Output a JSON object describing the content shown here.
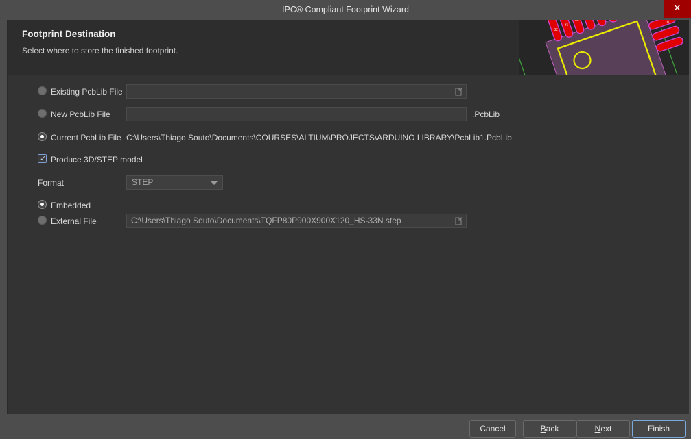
{
  "window": {
    "title": "IPC® Compliant Footprint Wizard",
    "close_label": "✕",
    "close_icon": "close-icon"
  },
  "banner": {
    "heading": "Footprint Destination",
    "subheading": "Select where to store the finished footprint.",
    "artwork": "pcb-footprint-preview"
  },
  "form": {
    "destination_group": {
      "options": [
        {
          "id": "existing-pcblib-file",
          "label": "Existing PcbLib File",
          "selected": false,
          "field_value": "",
          "field_placeholder": "",
          "has_browse": true,
          "browse_icon": "browse-file-icon"
        },
        {
          "id": "new-pcblib-file",
          "label": "New PcbLib File",
          "selected": false,
          "field_value": "",
          "field_placeholder": "",
          "suffix": ".PcbLib",
          "has_browse": false
        },
        {
          "id": "current-pcblib-file",
          "label": "Current PcbLib File",
          "selected": true,
          "path": "C:\\Users\\Thiago Souto\\Documents\\COURSES\\ALTIUM\\PROJECTS\\ARDUINO LIBRARY\\PcbLib1.PcbLib"
        }
      ]
    },
    "produce_3d": {
      "label": "Produce 3D/STEP model",
      "checked": true,
      "check_glyph": "✓"
    },
    "format": {
      "label": "Format",
      "value": "STEP",
      "options": [
        "STEP"
      ]
    },
    "model_storage_group": {
      "options": [
        {
          "id": "embedded",
          "label": "Embedded",
          "selected": true
        },
        {
          "id": "external-file",
          "label": "External File",
          "selected": false,
          "field_value": "C:\\Users\\Thiago Souto\\Documents\\TQFP80P900X900X120_HS-33N.step",
          "has_browse": true,
          "browse_icon": "browse-file-icon"
        }
      ]
    }
  },
  "footer": {
    "buttons": [
      {
        "id": "cancel",
        "label": "Cancel",
        "accel": "",
        "primary": false
      },
      {
        "id": "back",
        "label": "Back",
        "accel": "B",
        "primary": false
      },
      {
        "id": "next",
        "label": "Next",
        "accel": "N",
        "primary": false
      },
      {
        "id": "finish",
        "label": "Finish",
        "accel": "",
        "primary": true
      }
    ]
  },
  "colors": {
    "window_bg": "#4d4d4d",
    "panel_bg": "#333333",
    "banner_bg": "#2d2d2d",
    "close_red": "#a00000",
    "accent_blue": "#7aa9dd",
    "pad_red": "#e00000",
    "courtyard_green": "#3fa63f",
    "silk_yellow": "#e8e800",
    "pad_outline_magenta": "#cc44cc"
  }
}
